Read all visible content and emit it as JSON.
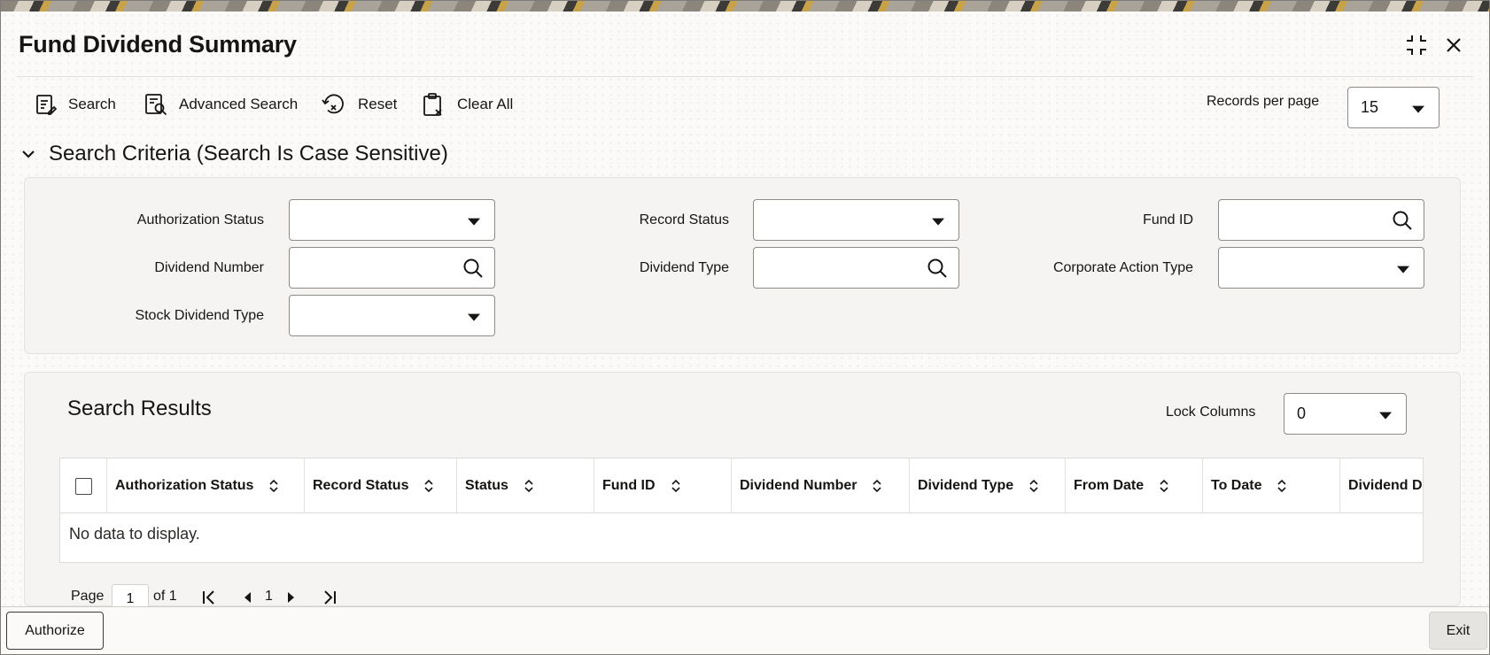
{
  "window": {
    "title": "Fund Dividend Summary"
  },
  "toolbar": {
    "search_label": "Search",
    "advanced_search_label": "Advanced Search",
    "reset_label": "Reset",
    "clear_all_label": "Clear All",
    "records_per_page_label": "Records per page",
    "records_per_page_value": "15"
  },
  "criteria": {
    "heading": "Search Criteria (Search Is Case Sensitive)",
    "authorization_status_label": "Authorization Status",
    "dividend_number_label": "Dividend Number",
    "stock_dividend_type_label": "Stock Dividend Type",
    "record_status_label": "Record Status",
    "dividend_type_label": "Dividend Type",
    "fund_id_label": "Fund ID",
    "corporate_action_type_label": "Corporate Action Type"
  },
  "results": {
    "heading": "Search Results",
    "lock_columns_label": "Lock Columns",
    "lock_columns_value": "0",
    "columns": [
      "Authorization Status",
      "Record Status",
      "Status",
      "Fund ID",
      "Dividend Number",
      "Dividend Type",
      "From Date",
      "To Date",
      "Dividend D"
    ],
    "empty_message": "No data to display."
  },
  "pager": {
    "page_label": "Page",
    "page_value": "1",
    "of_label": "of 1",
    "current_page": "1"
  },
  "footer": {
    "authorize_label": "Authorize",
    "exit_label": "Exit"
  },
  "icons": {
    "maximize": "maximize-icon",
    "close": "close-icon",
    "search": "search-icon",
    "advanced_search": "advanced-search-icon",
    "reset": "reset-icon",
    "clear_all": "clear-all-icon",
    "collapse": "chevron-down-icon",
    "sort": "sort-icon"
  }
}
